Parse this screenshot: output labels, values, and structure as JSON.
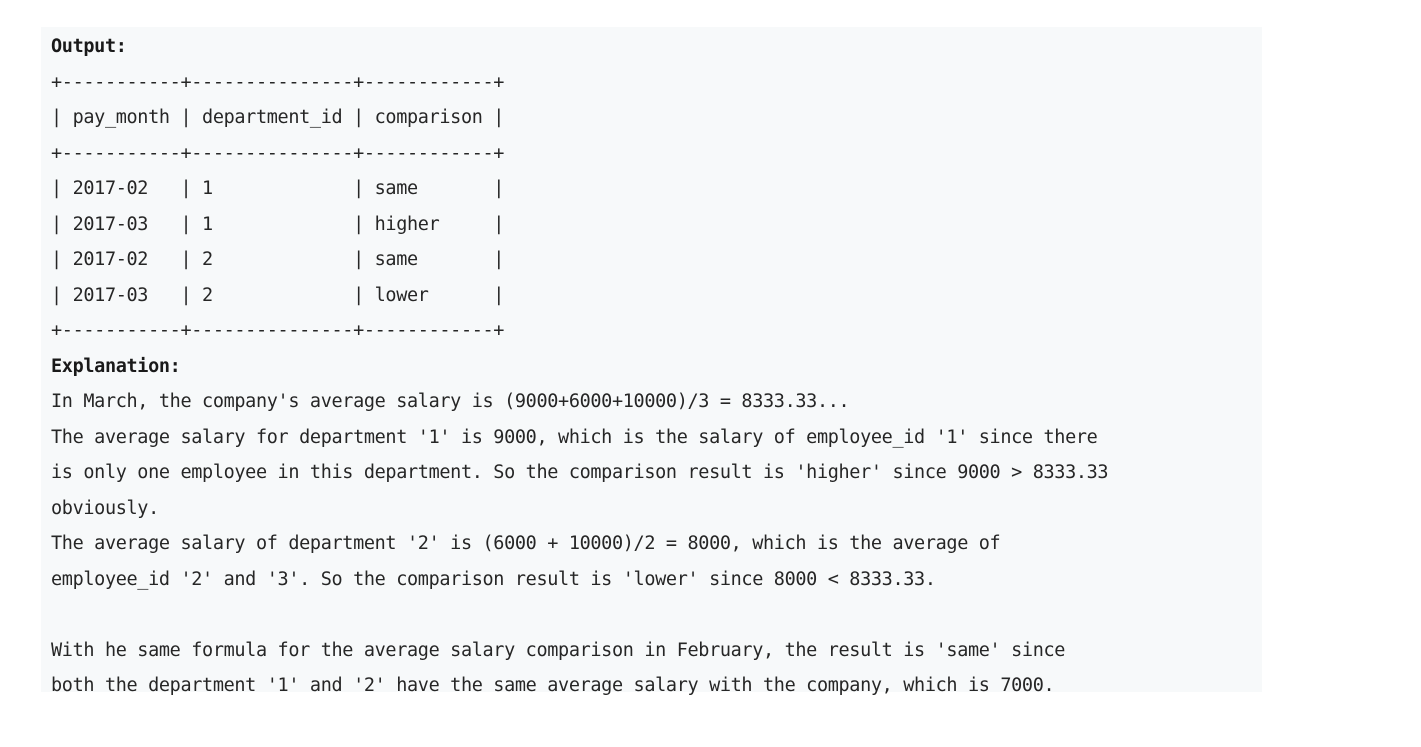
{
  "output_heading": "Output:",
  "table_text": {
    "border": "+-----------+---------------+------------+",
    "header": "| pay_month | department_id | comparison |",
    "rows": [
      "| 2017-02   | 1             | same       |",
      "| 2017-03   | 1             | higher     |",
      "| 2017-02   | 2             | same       |",
      "| 2017-03   | 2             | lower      |"
    ]
  },
  "explanation_heading": "Explanation:",
  "explanation_lines": [
    "In March, the company's average salary is (9000+6000+10000)/3 = 8333.33...",
    "The average salary for department '1' is 9000, which is the salary of employee_id '1' since there",
    "is only one employee in this department. So the comparison result is 'higher' since 9000 > 8333.33",
    "obviously.",
    "The average salary of department '2' is (6000 + 10000)/2 = 8000, which is the average of",
    "employee_id '2' and '3'. So the comparison result is 'lower' since 8000 < 8333.33.",
    "",
    "With he same formula for the average salary comparison in February, the result is 'same' since",
    "both the department '1' and '2' have the same average salary with the company, which is 7000."
  ]
}
